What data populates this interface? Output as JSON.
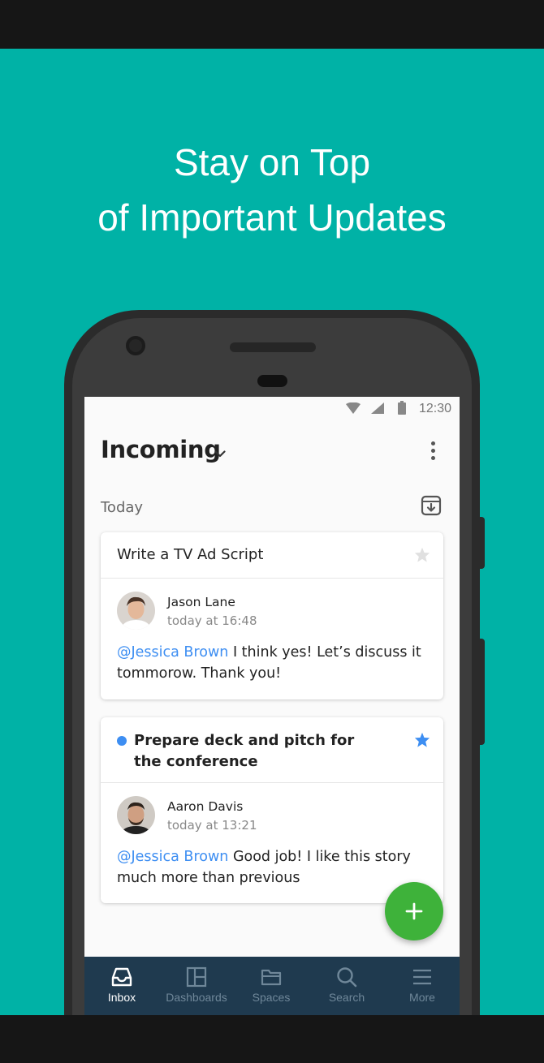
{
  "headline": {
    "line1": "Stay on Top",
    "line2": "of Important Updates"
  },
  "statusbar": {
    "time": "12:30",
    "icons": [
      "wifi-icon",
      "signal-icon",
      "battery-icon"
    ]
  },
  "header": {
    "title": "Incoming",
    "menu_icon": "more-vert-icon"
  },
  "section": {
    "label": "Today",
    "action_icon": "archive-icon"
  },
  "cards": [
    {
      "title": "Write a TV Ad Script",
      "starred": false,
      "unread": false,
      "author": "Jason Lane",
      "time": "today at 16:48",
      "mention": "@Jessica Brown",
      "message": "I think yes! Let’s discuss it tommorow. Thank you!"
    },
    {
      "title": "Prepare deck and pitch for the conference",
      "starred": true,
      "unread": true,
      "author": "Aaron Davis",
      "time": "today at 13:21",
      "mention": "@Jessica Brown",
      "message": "Good job! I like this story much more than previous"
    }
  ],
  "fab": {
    "icon": "plus-icon",
    "color": "#3eb23a"
  },
  "nav": {
    "items": [
      {
        "label": "Inbox",
        "icon": "inbox-icon",
        "active": true
      },
      {
        "label": "Dashboards",
        "icon": "dashboard-icon",
        "active": false
      },
      {
        "label": "Spaces",
        "icon": "folder-icon",
        "active": false
      },
      {
        "label": "Search",
        "icon": "search-icon",
        "active": false
      },
      {
        "label": "More",
        "icon": "menu-icon",
        "active": false
      }
    ]
  },
  "colors": {
    "background": "#00b2a6",
    "accent": "#3d8ef2",
    "navbar": "#1f3a4f"
  }
}
